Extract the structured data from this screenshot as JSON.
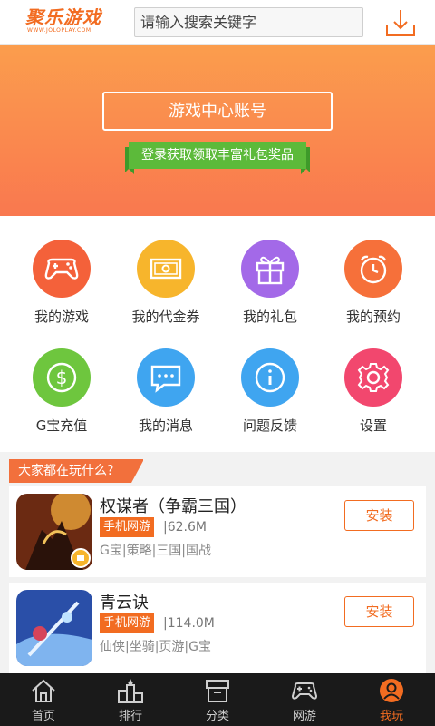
{
  "header": {
    "logo_text": "聚乐游戏",
    "logo_sub": "WWW.JOLOPLAY.COM",
    "search_placeholder": "请输入搜索关键字",
    "download_icon": "download-icon"
  },
  "hero": {
    "account_button": "游戏中心账号",
    "ribbon_text": "登录获取领取丰富礼包奖品"
  },
  "grid": [
    {
      "label": "我的游戏",
      "icon": "gamepad-icon",
      "color": "#f4613a"
    },
    {
      "label": "我的代金券",
      "icon": "voucher-icon",
      "color": "#f7b52c"
    },
    {
      "label": "我的礼包",
      "icon": "gift-icon",
      "color": "#a369e8"
    },
    {
      "label": "我的预约",
      "icon": "alarm-clock-icon",
      "color": "#f6703a"
    },
    {
      "label": "G宝充值",
      "icon": "dollar-icon",
      "color": "#6ec63e"
    },
    {
      "label": "我的消息",
      "icon": "message-icon",
      "color": "#3fa5f0"
    },
    {
      "label": "问题反馈",
      "icon": "info-icon",
      "color": "#3fa5f0"
    },
    {
      "label": "设置",
      "icon": "gear-icon",
      "color": "#f2476e"
    }
  ],
  "section": {
    "title": "大家都在玩什么？"
  },
  "games": [
    {
      "title": "权谋者（争霸三国）",
      "type": "手机网游",
      "size": "|62.6M",
      "tags": "G宝|策略|三国|国战",
      "install": "安装"
    },
    {
      "title": "青云诀",
      "type": "手机网游",
      "size": "|114.0M",
      "tags": "仙侠|坐骑|页游|G宝",
      "install": "安装"
    }
  ],
  "nav": [
    {
      "label": "首页",
      "icon": "home-icon",
      "active": false
    },
    {
      "label": "排行",
      "icon": "ranking-icon",
      "active": false
    },
    {
      "label": "分类",
      "icon": "category-box-icon",
      "active": false
    },
    {
      "label": "网游",
      "icon": "gamepad-icon",
      "active": false
    },
    {
      "label": "我玩",
      "icon": "user-icon",
      "active": true
    }
  ],
  "colors": {
    "accent": "#f26c21",
    "hero_top": "#fb9d4d",
    "hero_bottom": "#f9784f",
    "ribbon": "#5cba3a",
    "nav_bg": "#1a1a1a"
  }
}
